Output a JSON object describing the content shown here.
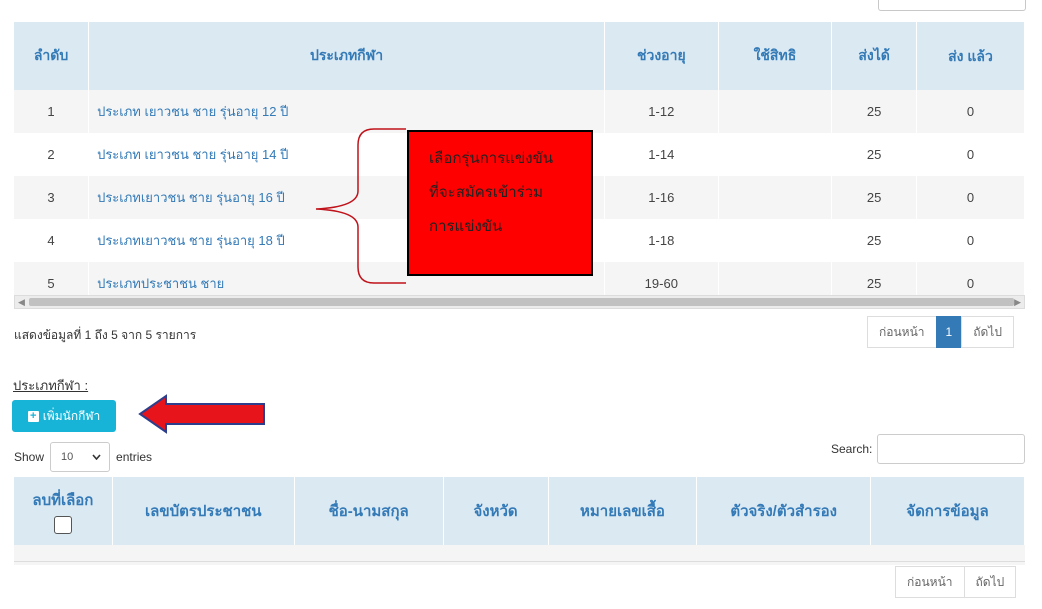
{
  "sports_table": {
    "headers": [
      "ลำดับ",
      "ประเภทกีฬา",
      "ช่วงอายุ",
      "ใช้สิทธิ",
      "ส่งได้",
      "ส่ง แล้ว"
    ],
    "rows": [
      {
        "no": "1",
        "name": "ประเภท เยาวชน ชาย รุ่นอายุ 12 ปี",
        "age": "1-12",
        "right": "",
        "quota": "25",
        "sent": "0"
      },
      {
        "no": "2",
        "name": "ประเภท เยาวชน ชาย รุ่นอายุ 14 ปี",
        "age": "1-14",
        "right": "",
        "quota": "25",
        "sent": "0"
      },
      {
        "no": "3",
        "name": "ประเภทเยาวชน ชาย รุ่นอายุ 16 ปี",
        "age": "1-16",
        "right": "",
        "quota": "25",
        "sent": "0"
      },
      {
        "no": "4",
        "name": "ประเภทเยาวชน ชาย รุ่นอายุ 18 ปี",
        "age": "1-18",
        "right": "",
        "quota": "25",
        "sent": "0"
      },
      {
        "no": "5",
        "name": "ประเภทประชาชน ชาย",
        "age": "19-60",
        "right": "",
        "quota": "25",
        "sent": "0"
      }
    ]
  },
  "annotation": {
    "lines": [
      "เลือกรุ่นการแข่งขัน",
      "ที่จะสมัครเข้าร่วม",
      "การแข่งขัน"
    ],
    "box_color": "#ff0000",
    "arrow_color": "#e8141b"
  },
  "info_text": "แสดงข้อมูลที่ 1 ถึง 5 จาก 5 รายการ",
  "pager1": {
    "prev": "ก่อนหน้า",
    "page": "1",
    "next": "ถัดไป"
  },
  "section_label": "ประเภทกีฬา :",
  "add_button": {
    "icon": "plus-square-icon",
    "label": "เพิ่มนักกีฬา"
  },
  "length": {
    "show": "Show",
    "value": "10",
    "entries": "entries"
  },
  "search": {
    "label": "Search:",
    "value": ""
  },
  "athletes_table": {
    "headers": [
      "ลบที่เลือก",
      "เลขบัตรประชาชน",
      "ชื่อ-นามสกุล",
      "จังหวัด",
      "หมายเลขเสื้อ",
      "ตัวจริง/ตัวสำรอง",
      "จัดการข้อมูล"
    ]
  },
  "pager2": {
    "prev": "ก่อนหน้า",
    "next": "ถัดไป"
  },
  "colors": {
    "header_bg": "#dbe9f3",
    "link": "#337ab7",
    "button": "#17b4d8"
  }
}
